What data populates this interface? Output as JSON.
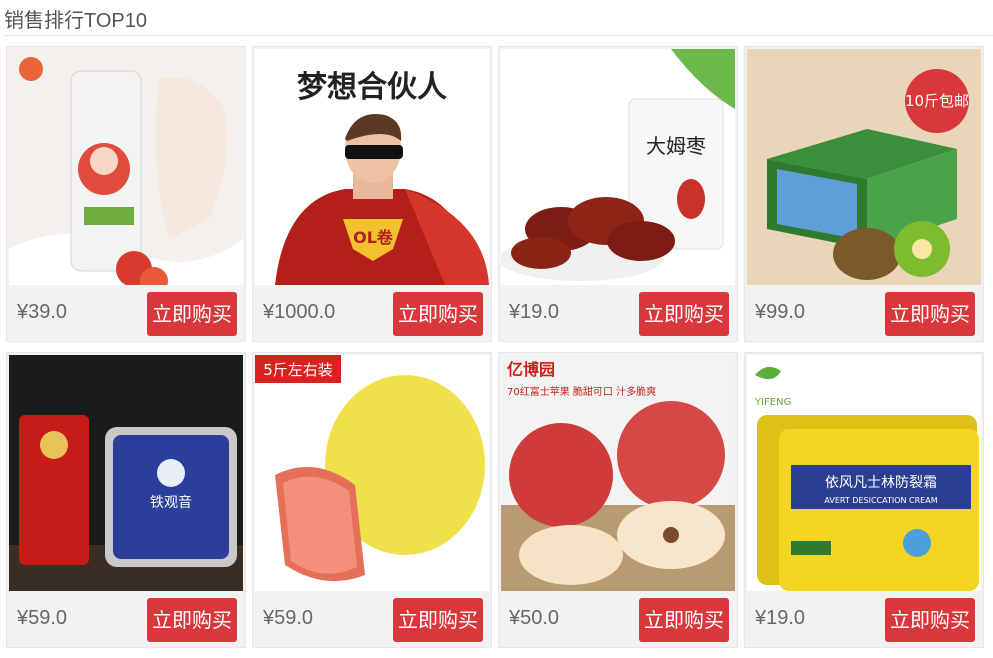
{
  "section": {
    "title": "销售排行TOP10"
  },
  "products": [
    {
      "price": "¥39.0",
      "buy_label": "立即购买",
      "image_name": "hand-cream-product-image"
    },
    {
      "price": "¥1000.0",
      "buy_label": "立即购买",
      "image_name": "dream-partner-product-image",
      "image_text": "梦想合伙人",
      "emblem_text": "OL卷"
    },
    {
      "price": "¥19.0",
      "buy_label": "立即购买",
      "image_name": "red-dates-product-image",
      "image_text": "大姆枣"
    },
    {
      "price": "¥99.0",
      "buy_label": "立即购买",
      "image_name": "kiwi-box-product-image",
      "badge_text": "10斤包邮"
    },
    {
      "price": "¥59.0",
      "buy_label": "立即购买",
      "image_name": "tieguanyin-tea-product-image",
      "image_text": "铁观音"
    },
    {
      "price": "¥59.0",
      "buy_label": "立即购买",
      "image_name": "pomelo-product-image",
      "badge_text": "5斤左右装"
    },
    {
      "price": "¥50.0",
      "buy_label": "立即购买",
      "image_name": "apple-product-image",
      "image_text": "亿博园",
      "tagline": "70红富士苹果 脆甜可口 汁多脆爽"
    },
    {
      "price": "¥19.0",
      "buy_label": "立即购买",
      "image_name": "vaseline-cream-product-image",
      "image_text": "依风凡士林防裂霜",
      "sub_text": "AVERT DESICCATION CREAM",
      "brand_text": "YIFENG"
    }
  ]
}
